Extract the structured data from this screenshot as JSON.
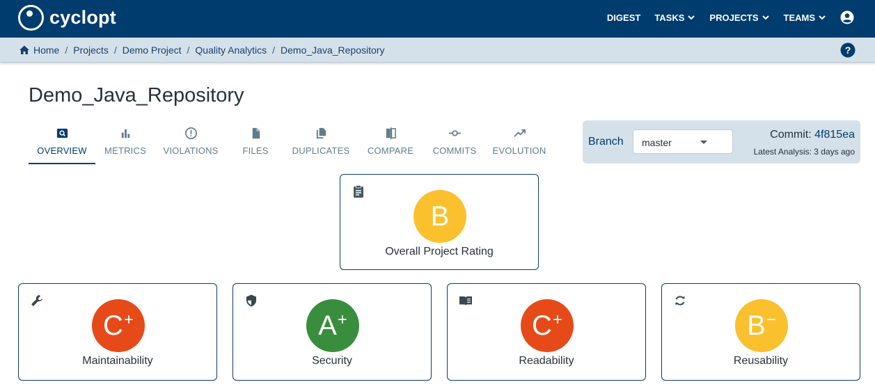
{
  "app": {
    "logo_text": "cyclopt"
  },
  "topnav": {
    "items": [
      {
        "label": "DIGEST",
        "has_menu": false
      },
      {
        "label": "TASKS",
        "has_menu": true
      },
      {
        "label": "PROJECTS",
        "has_menu": true
      },
      {
        "label": "TEAMS",
        "has_menu": true
      }
    ]
  },
  "breadcrumb": [
    "Home",
    "Projects",
    "Demo Project",
    "Quality Analytics",
    "Demo_Java_Repository"
  ],
  "page": {
    "title": "Demo_Java_Repository"
  },
  "tabs": [
    {
      "label": "OVERVIEW",
      "icon": "overview-icon",
      "active": true
    },
    {
      "label": "METRICS",
      "icon": "bar-chart-icon"
    },
    {
      "label": "VIOLATIONS",
      "icon": "alert-circle-icon"
    },
    {
      "label": "FILES",
      "icon": "file-icon"
    },
    {
      "label": "DUPLICATES",
      "icon": "duplicate-icon"
    },
    {
      "label": "COMPARE",
      "icon": "compare-icon"
    },
    {
      "label": "COMMITS",
      "icon": "commit-icon"
    },
    {
      "label": "EVOLUTION",
      "icon": "trending-up-icon"
    }
  ],
  "branch": {
    "label": "Branch",
    "selected": "master",
    "commit_label": "Commit:",
    "commit_hash": "4f815ea",
    "latest_analysis": "Latest Analysis: 3 days ago"
  },
  "overall": {
    "grade": "B",
    "modifier": "",
    "label": "Overall Project Rating",
    "color": "#fbc02d",
    "icon": "clipboard-icon"
  },
  "ratings": [
    {
      "grade": "C",
      "modifier": "+",
      "label": "Maintainability",
      "color": "#e64a19",
      "icon": "wrench-icon"
    },
    {
      "grade": "A",
      "modifier": "+",
      "label": "Security",
      "color": "#388e3c",
      "icon": "shield-icon"
    },
    {
      "grade": "C",
      "modifier": "+",
      "label": "Readability",
      "color": "#e64a19",
      "icon": "book-icon"
    },
    {
      "grade": "B",
      "modifier": "−",
      "label": "Reusability",
      "color": "#fbc02d",
      "icon": "sync-icon"
    }
  ],
  "colors": {
    "brand": "#003c6e",
    "crumb_bar": "#d5e1ea"
  }
}
